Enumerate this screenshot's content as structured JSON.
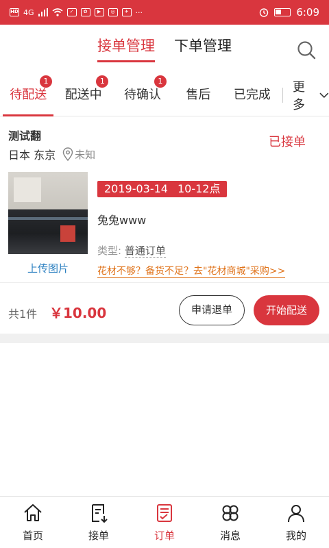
{
  "status_bar": {
    "left_icons": [
      "hd-icon",
      "signal-icon",
      "wifi-icon",
      "app-icons"
    ],
    "network": "4G",
    "time": "6:09"
  },
  "header": {
    "tabs": [
      {
        "label": "接单管理",
        "active": true
      },
      {
        "label": "下单管理",
        "active": false
      }
    ]
  },
  "status_tabs": [
    {
      "label": "待配送",
      "badge": "1",
      "active": true
    },
    {
      "label": "配送中",
      "badge": "1",
      "active": false
    },
    {
      "label": "待确认",
      "badge": "1",
      "active": false
    },
    {
      "label": "售后",
      "badge": "",
      "active": false
    },
    {
      "label": "已完成",
      "badge": "",
      "active": false
    }
  ],
  "more_label": "更多",
  "order": {
    "shop_name": "测试翻",
    "status": "已接单",
    "location": "日本 东京",
    "location_unknown": "未知",
    "upload_label": "上传图片",
    "date": "2019-03-14",
    "time_slot": "10-12点",
    "product": "兔兔www",
    "type_label": "类型:",
    "type_value": "普通订单",
    "promo": "花材不够？备货不足？去\"花材商城\"采购>>",
    "count": "共1件",
    "price": "￥10.00",
    "refund_label": "申请退单",
    "deliver_label": "开始配送"
  },
  "bottom_nav": [
    {
      "label": "首页",
      "icon": "home-icon",
      "active": false
    },
    {
      "label": "接单",
      "icon": "receive-order-icon",
      "active": false
    },
    {
      "label": "订单",
      "icon": "order-list-icon",
      "active": true
    },
    {
      "label": "消息",
      "icon": "message-icon",
      "active": false
    },
    {
      "label": "我的",
      "icon": "profile-icon",
      "active": false
    }
  ],
  "colors": {
    "accent": "#d9363e",
    "link": "#2a7fc0",
    "promo": "#e0741c"
  }
}
